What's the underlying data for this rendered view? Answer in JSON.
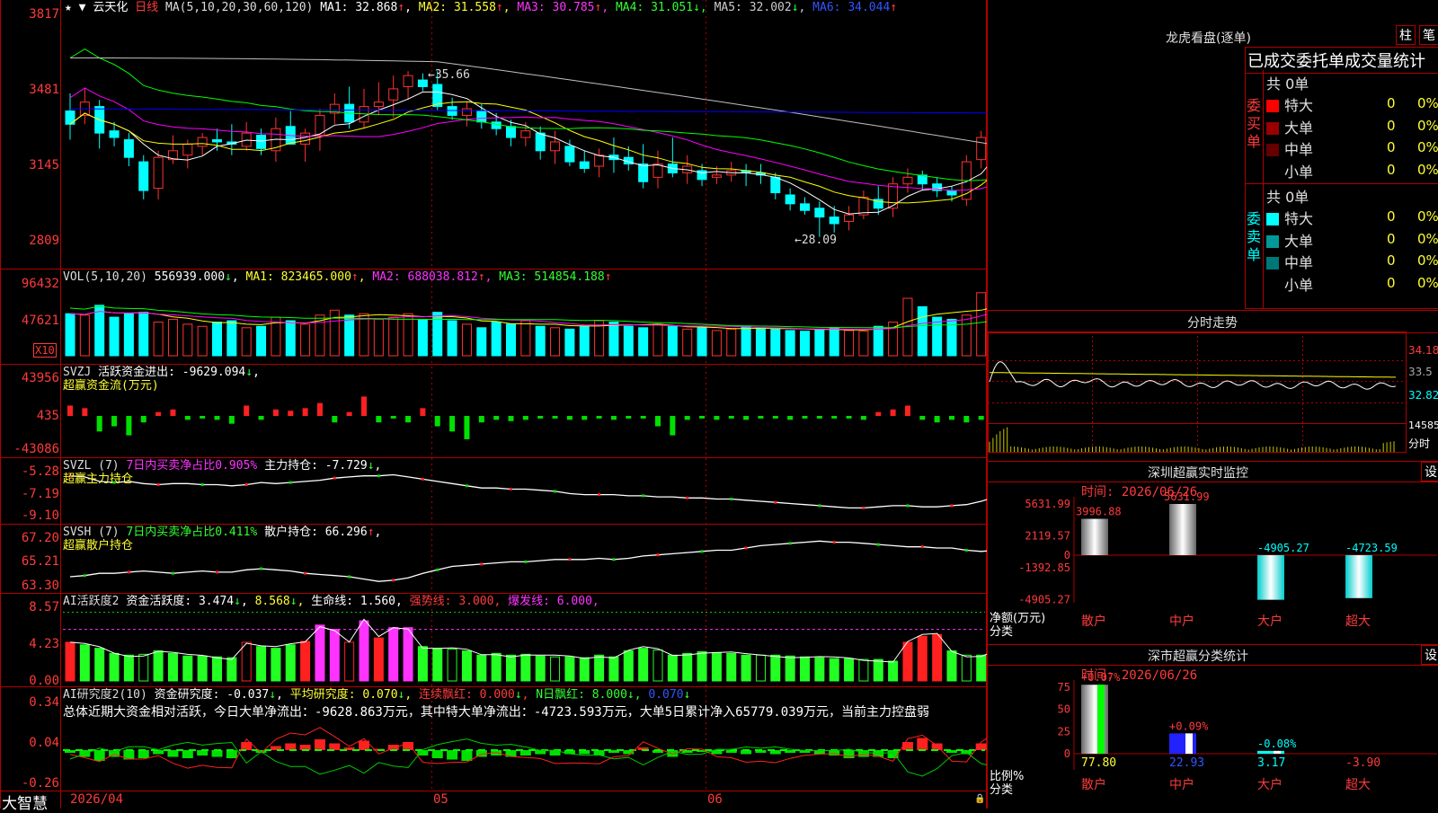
{
  "colors": {
    "up": "#ff3232",
    "down": "#00ffff",
    "axis": "#b00000",
    "ma1": "#ffffff",
    "ma2": "#ffff00",
    "ma3": "#ff00ff",
    "ma4": "#00ff00",
    "ma5": "#c0c0c0",
    "ma6": "#0000ff"
  },
  "header": {
    "stock": "云天化",
    "period": "日线",
    "ma_title": "MA(5,10,20,30,60,120)",
    "ma_items": [
      {
        "label": "MA1:",
        "value": "32.868",
        "arrow": "↑"
      },
      {
        "label": "MA2:",
        "value": "31.558",
        "arrow": "↑"
      },
      {
        "label": "MA3:",
        "value": "30.785",
        "arrow": "↑"
      },
      {
        "label": "MA4:",
        "value": "31.051",
        "arrow": "↓"
      },
      {
        "label": "MA5:",
        "value": "32.002",
        "arrow": "↓"
      },
      {
        "label": "MA6:",
        "value": "34.044",
        "arrow": "↑"
      }
    ]
  },
  "price_axis": {
    "ticks": [
      "3817",
      "3481",
      "3145",
      "2809"
    ]
  },
  "annotations": {
    "high": "35.66",
    "low": "28.09"
  },
  "vol_panel": {
    "title": "VOL(5,10,20)",
    "value": "556939.000",
    "ma1": "MA1: 823465.000",
    "ma2": "MA2: 688038.812",
    "ma3": "MA3: 514854.188",
    "ticks": [
      "96432",
      "47621"
    ],
    "unit": "X10"
  },
  "svzj_panel": {
    "title": "SVZJ",
    "label": "活跃资金进出: -9629.094",
    "subtitle": "超赢资金流(万元)",
    "ticks": [
      "43956",
      "435",
      "-43086"
    ]
  },
  "svzl_panel": {
    "title": "SVZL (7)",
    "label1": "7日内买卖净占比0.905%",
    "label2": "主力持仓: -7.729",
    "subtitle": "超赢主力持仓",
    "ticks": [
      "-5.28",
      "-7.19",
      "-9.10"
    ]
  },
  "svsh_panel": {
    "title": "SVSH (7)",
    "label1": "7日内买卖净占比0.411%",
    "label2": "散户持仓: 66.296",
    "subtitle": "超赢散户持仓",
    "ticks": [
      "67.20",
      "65.21",
      "63.30"
    ]
  },
  "ai_panel": {
    "title": "AI活跃度2",
    "label1": "资金活跃度: 3.474",
    "label2": "8.568",
    "label3": "生命线: 1.560",
    "label4": "强势线: 3.000",
    "label5": "爆发线: 6.000",
    "ticks": [
      "8.57",
      "4.23",
      "0.00"
    ]
  },
  "ai2_panel": {
    "title": "AI研究度2(10)",
    "label1": "资金研究度: -0.037",
    "label2": "平均研究度: 0.070",
    "label3": "连续飘红: 0.000",
    "label4": "N日飘红: 8.000",
    "label5": "0.070",
    "ticks": [
      "0.34",
      "0.04",
      "-0.26"
    ],
    "summary": "总体近期大资金相对活跃，今日大单净流出：-9628.863万元，其中特大单净流出：-4723.593万元，大单5日累计净入65779.039万元，当前主力控盘弱"
  },
  "footer": {
    "brand": "大智慧",
    "dates": [
      "2026/04",
      "05",
      "06"
    ]
  },
  "chart_data": {
    "type": "candlestick",
    "title": "云天化 日线",
    "ylim": [
      28.09,
      38.17
    ],
    "ohlc": [
      [
        33.8,
        34.6,
        32.5,
        33.2
      ],
      [
        33.6,
        34.8,
        33.2,
        34.2
      ],
      [
        34.0,
        34.3,
        32.1,
        32.8
      ],
      [
        32.9,
        33.3,
        32.2,
        32.6
      ],
      [
        32.5,
        32.8,
        31.3,
        31.7
      ],
      [
        31.5,
        31.8,
        29.8,
        30.2
      ],
      [
        30.3,
        32.0,
        29.8,
        31.7
      ],
      [
        31.6,
        32.7,
        31.4,
        32.0
      ],
      [
        31.8,
        32.5,
        31.2,
        32.3
      ],
      [
        32.2,
        32.8,
        31.8,
        32.6
      ],
      [
        32.5,
        33.0,
        32.0,
        32.4
      ],
      [
        32.4,
        33.2,
        31.8,
        32.3
      ],
      [
        32.2,
        33.3,
        32.0,
        32.8
      ],
      [
        32.7,
        33.0,
        31.8,
        32.1
      ],
      [
        32.0,
        33.5,
        31.5,
        33.0
      ],
      [
        33.1,
        33.8,
        32.6,
        32.3
      ],
      [
        32.3,
        33.0,
        31.5,
        32.8
      ],
      [
        32.7,
        33.9,
        32.0,
        33.6
      ],
      [
        33.7,
        34.6,
        33.2,
        34.1
      ],
      [
        34.1,
        34.9,
        33.0,
        33.3
      ],
      [
        33.3,
        34.8,
        33.0,
        34.0
      ],
      [
        34.0,
        35.1,
        33.6,
        34.2
      ],
      [
        34.3,
        35.4,
        33.5,
        34.8
      ],
      [
        34.9,
        35.6,
        34.3,
        35.4
      ],
      [
        35.2,
        35.5,
        34.7,
        34.9
      ],
      [
        35.0,
        35.6,
        33.8,
        34.0
      ],
      [
        34.0,
        34.4,
        33.4,
        33.6
      ],
      [
        33.6,
        34.2,
        33.1,
        33.9
      ],
      [
        33.8,
        34.1,
        33.0,
        33.3
      ],
      [
        33.3,
        33.7,
        32.7,
        33.0
      ],
      [
        33.1,
        33.4,
        32.2,
        32.6
      ],
      [
        32.6,
        33.3,
        32.2,
        32.9
      ],
      [
        32.8,
        33.1,
        31.6,
        32.0
      ],
      [
        32.0,
        32.9,
        31.4,
        32.4
      ],
      [
        32.2,
        32.5,
        31.3,
        31.5
      ],
      [
        31.5,
        32.0,
        31.0,
        31.2
      ],
      [
        31.3,
        32.1,
        30.8,
        31.8
      ],
      [
        31.8,
        32.6,
        31.0,
        31.6
      ],
      [
        31.7,
        32.2,
        31.1,
        31.4
      ],
      [
        31.4,
        32.3,
        30.3,
        30.6
      ],
      [
        30.8,
        32.0,
        30.3,
        31.4
      ],
      [
        31.4,
        32.6,
        30.8,
        31.0
      ],
      [
        31.0,
        31.8,
        30.5,
        31.3
      ],
      [
        31.1,
        31.4,
        30.4,
        30.7
      ],
      [
        30.8,
        31.3,
        30.5,
        30.9
      ],
      [
        30.9,
        31.5,
        30.6,
        31.1
      ],
      [
        31.1,
        31.4,
        30.4,
        31.0
      ],
      [
        31.0,
        31.4,
        30.5,
        30.9
      ],
      [
        30.8,
        31.0,
        29.8,
        30.1
      ],
      [
        30.0,
        30.3,
        29.3,
        29.6
      ],
      [
        29.6,
        29.9,
        29.1,
        29.3
      ],
      [
        29.4,
        29.7,
        28.1,
        29.0
      ],
      [
        29.0,
        29.5,
        28.3,
        28.7
      ],
      [
        28.8,
        29.5,
        28.4,
        29.1
      ],
      [
        29.1,
        30.2,
        28.9,
        29.9
      ],
      [
        29.8,
        30.4,
        29.1,
        29.4
      ],
      [
        29.4,
        30.8,
        29.0,
        30.5
      ],
      [
        30.5,
        31.2,
        30.1,
        30.8
      ],
      [
        30.9,
        31.1,
        30.2,
        30.5
      ],
      [
        30.5,
        30.8,
        29.9,
        30.2
      ],
      [
        30.2,
        30.4,
        29.7,
        30.0
      ],
      [
        29.8,
        31.8,
        29.5,
        31.5
      ],
      [
        31.6,
        32.9,
        31.2,
        32.6
      ],
      [
        32.5,
        34.5,
        31.9,
        34.4
      ],
      [
        34.4,
        34.9,
        33.5,
        33.8
      ],
      [
        33.6,
        33.9,
        32.4,
        32.6
      ]
    ],
    "vol": [
      60,
      58,
      72,
      55,
      60,
      62,
      48,
      52,
      45,
      42,
      48,
      50,
      40,
      42,
      55,
      50,
      45,
      58,
      65,
      58,
      60,
      52,
      55,
      60,
      52,
      62,
      50,
      45,
      40,
      48,
      45,
      50,
      42,
      40,
      38,
      42,
      50,
      48,
      42,
      40,
      45,
      42,
      38,
      40,
      36,
      38,
      42,
      40,
      38,
      36,
      35,
      38,
      40,
      36,
      35,
      42,
      48,
      82,
      70,
      55,
      52,
      58,
      90,
      95,
      88,
      55
    ],
    "svzj": [
      8000,
      6000,
      -12000,
      -8000,
      -15000,
      -5000,
      3000,
      5000,
      -3000,
      -2000,
      -3000,
      -6000,
      8000,
      -3000,
      5000,
      4000,
      6000,
      10000,
      -5000,
      3000,
      15000,
      -5000,
      -2000,
      -5000,
      6000,
      -8000,
      -12000,
      -18000,
      -5000,
      -3000,
      -4000,
      -3000,
      -2000,
      -2000,
      -3000,
      -3000,
      -2000,
      -3000,
      -2000,
      -2000,
      -8000,
      -15000,
      -3000,
      -2000,
      -3000,
      -2000,
      -3000,
      -2000,
      -2000,
      -3000,
      -2000,
      -2000,
      -2000,
      -2000,
      -3000,
      3000,
      5000,
      8000,
      -3000,
      -5000,
      -3000,
      -5000,
      -3000,
      25000,
      -4000,
      18000,
      -2000,
      -4000
    ],
    "svzl": [
      -5.5,
      -5.6,
      -6.0,
      -6.1,
      -6.0,
      -6.2,
      -6.3,
      -6.2,
      -6.2,
      -6.3,
      -6.3,
      -6.4,
      -6.3,
      -6.1,
      -6.2,
      -6.1,
      -6.0,
      -5.9,
      -5.7,
      -5.6,
      -5.5,
      -5.5,
      -5.4,
      -5.6,
      -5.8,
      -6.0,
      -6.2,
      -6.4,
      -6.6,
      -6.6,
      -6.7,
      -6.7,
      -6.8,
      -6.9,
      -7.1,
      -7.2,
      -7.2,
      -7.2,
      -7.3,
      -7.3,
      -7.4,
      -7.4,
      -7.5,
      -7.5,
      -7.6,
      -7.6,
      -7.7,
      -7.8,
      -7.9,
      -8.0,
      -8.1,
      -8.2,
      -8.3,
      -8.4,
      -8.4,
      -8.3,
      -8.2,
      -8.2,
      -8.3,
      -8.3,
      -8.2,
      -8.1,
      -7.8,
      -7.4,
      -7.2,
      -7.3,
      -7.4,
      -7.7
    ],
    "svsh": [
      64.0,
      64.1,
      64.3,
      64.3,
      64.4,
      64.5,
      64.4,
      64.3,
      64.4,
      64.5,
      64.4,
      64.4,
      64.6,
      64.7,
      64.6,
      64.5,
      64.3,
      64.2,
      64.1,
      64.0,
      63.8,
      63.6,
      63.7,
      63.9,
      64.3,
      64.6,
      64.9,
      65.0,
      65.1,
      65.2,
      65.3,
      65.3,
      65.4,
      65.5,
      65.5,
      65.5,
      65.6,
      65.5,
      65.6,
      65.8,
      65.9,
      66.0,
      66.1,
      66.2,
      66.3,
      66.3,
      66.5,
      66.7,
      66.8,
      66.9,
      67.0,
      67.1,
      67.0,
      67.0,
      66.9,
      66.8,
      66.7,
      66.6,
      66.6,
      66.5,
      66.5,
      66.3,
      66.2,
      66.3,
      66.4,
      66.1,
      65.8,
      65.8
    ],
    "ai": [
      4.5,
      4.2,
      3.8,
      3.2,
      3.0,
      3.1,
      3.5,
      3.2,
      2.9,
      2.9,
      2.8,
      2.7,
      4.5,
      4.0,
      3.8,
      4.2,
      4.6,
      6.5,
      6.0,
      4.5,
      7.0,
      5.0,
      6.2,
      6.2,
      4.0,
      3.8,
      3.7,
      3.5,
      3.0,
      3.2,
      3.0,
      3.1,
      2.9,
      2.8,
      2.8,
      2.7,
      3.0,
      2.8,
      3.5,
      3.8,
      3.6,
      3.0,
      3.2,
      3.4,
      3.3,
      3.2,
      3.0,
      3.0,
      3.0,
      2.9,
      2.8,
      2.7,
      2.6,
      2.6,
      2.5,
      2.5,
      2.3,
      4.5,
      5.2,
      5.4,
      3.5,
      3.0,
      3.0,
      3.5,
      8.6,
      6.3,
      8.0,
      5.6,
      3.5
    ],
    "ai2": [
      -0.02,
      -0.05,
      -0.08,
      -0.05,
      -0.07,
      -0.06,
      -0.03,
      -0.05,
      -0.06,
      -0.04,
      -0.05,
      -0.06,
      0.06,
      -0.02,
      0.03,
      0.05,
      0.04,
      0.08,
      0.05,
      0.02,
      0.07,
      0.01,
      0.04,
      0.06,
      -0.04,
      -0.06,
      -0.07,
      -0.08,
      -0.05,
      -0.04,
      -0.05,
      -0.04,
      -0.03,
      -0.04,
      -0.03,
      -0.03,
      -0.04,
      -0.02,
      -0.03,
      0.02,
      -0.02,
      -0.05,
      -0.02,
      -0.01,
      -0.03,
      -0.02,
      -0.03,
      -0.02,
      -0.03,
      -0.02,
      -0.02,
      -0.03,
      -0.04,
      -0.06,
      -0.05,
      -0.05,
      -0.06,
      0.06,
      0.09,
      0.05,
      -0.02,
      -0.03,
      0.05,
      0.08,
      0.09,
      0.04,
      0.08,
      -0.02
    ]
  },
  "right_panel": {
    "dragon": {
      "title": "龙虎看盘(逐单)",
      "btn1": "柱",
      "btn2": "笔",
      "section": "已成交委托单成交量统计",
      "buy": {
        "side": "委买单",
        "total": "共 0单",
        "rows": [
          {
            "name": "特大",
            "val": "0",
            "pct": "0%",
            "color": "#ff0000"
          },
          {
            "name": "大单",
            "val": "0",
            "pct": "0%",
            "color": "#990000"
          },
          {
            "name": "中单",
            "val": "0",
            "pct": "0%",
            "color": "#660000"
          },
          {
            "name": "小单",
            "val": "0",
            "pct": "0%",
            "color": "#000000"
          }
        ]
      },
      "sell": {
        "side": "委卖单",
        "total": "共 0单",
        "rows": [
          {
            "name": "特大",
            "val": "0",
            "pct": "0%",
            "color": "#00ffff"
          },
          {
            "name": "大单",
            "val": "0",
            "pct": "0%",
            "color": "#009999"
          },
          {
            "name": "中单",
            "val": "0",
            "pct": "0%",
            "color": "#007777"
          },
          {
            "name": "小单",
            "val": "0",
            "pct": "0%",
            "color": "#000000"
          }
        ]
      }
    },
    "intraday": {
      "title": "分时走势",
      "ticks": [
        "34.18",
        "33.5",
        "32.82"
      ],
      "vol_tick": "14585",
      "vol_label": "分时"
    },
    "monitor": {
      "title": "深圳超赢实时监控",
      "btn": "设",
      "time": "时间: 2026/06/26",
      "ylabel1": "净额(万元)",
      "ylabel2": "分类",
      "ticks": [
        "5631.99",
        "2119.57",
        "0",
        "-1392.85",
        "-4905.27"
      ],
      "bars": [
        {
          "cat": "散户",
          "value": 3996.88,
          "label": "3996.88"
        },
        {
          "cat": "中户",
          "value": 5631.99,
          "label": "5631.99"
        },
        {
          "cat": "大户",
          "value": -4905.27,
          "label": "-4905.27"
        },
        {
          "cat": "超大",
          "value": -4723.59,
          "label": "-4723.59"
        }
      ]
    },
    "classify": {
      "title": "深市超赢分类统计",
      "btn": "设",
      "time": "时间: 2026/06/26",
      "ylabel1": "比例%",
      "ylabel2": "分类",
      "ticks": [
        "75",
        "50",
        "25",
        "0"
      ],
      "bars": [
        {
          "cat": "散户",
          "value": 77.8,
          "label": "77.80",
          "delta": "+0.07%"
        },
        {
          "cat": "中户",
          "value": 22.93,
          "label": "22.93",
          "delta": "+0.09%"
        },
        {
          "cat": "大户",
          "value": 3.17,
          "label": "3.17",
          "delta": "-0.08%"
        },
        {
          "cat": "超大",
          "value": -3.9,
          "label": "-3.90",
          "delta": ""
        }
      ]
    }
  }
}
